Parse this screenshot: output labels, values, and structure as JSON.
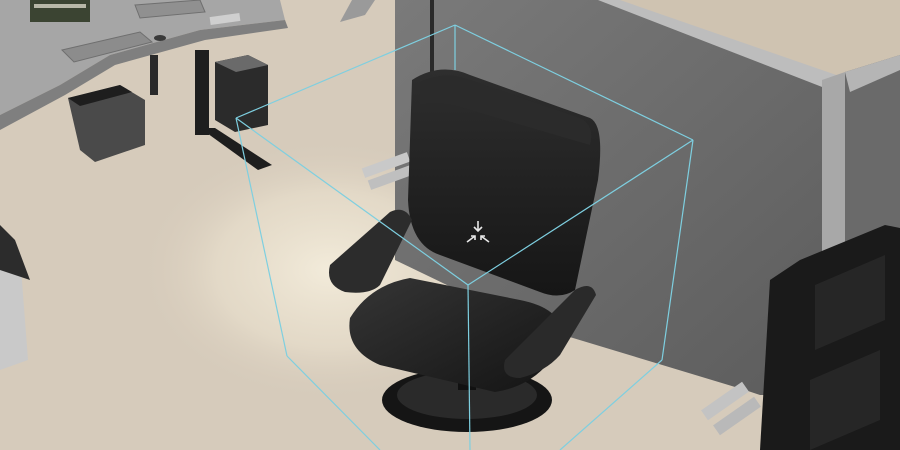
{
  "scene": {
    "view": "3d-viewport",
    "selected_object": "office-chair",
    "selection_indicator": "bounding-box",
    "cursor_icon": "move-cursor-icon"
  },
  "colors": {
    "floor": "#d8cdbd",
    "wall_panel": "#6e6e6e",
    "wall_trim": "#b9b9b9",
    "chair": "#1c1c1c",
    "bounding_box": "#7ecfe0",
    "desk": "#a9a9a9"
  }
}
